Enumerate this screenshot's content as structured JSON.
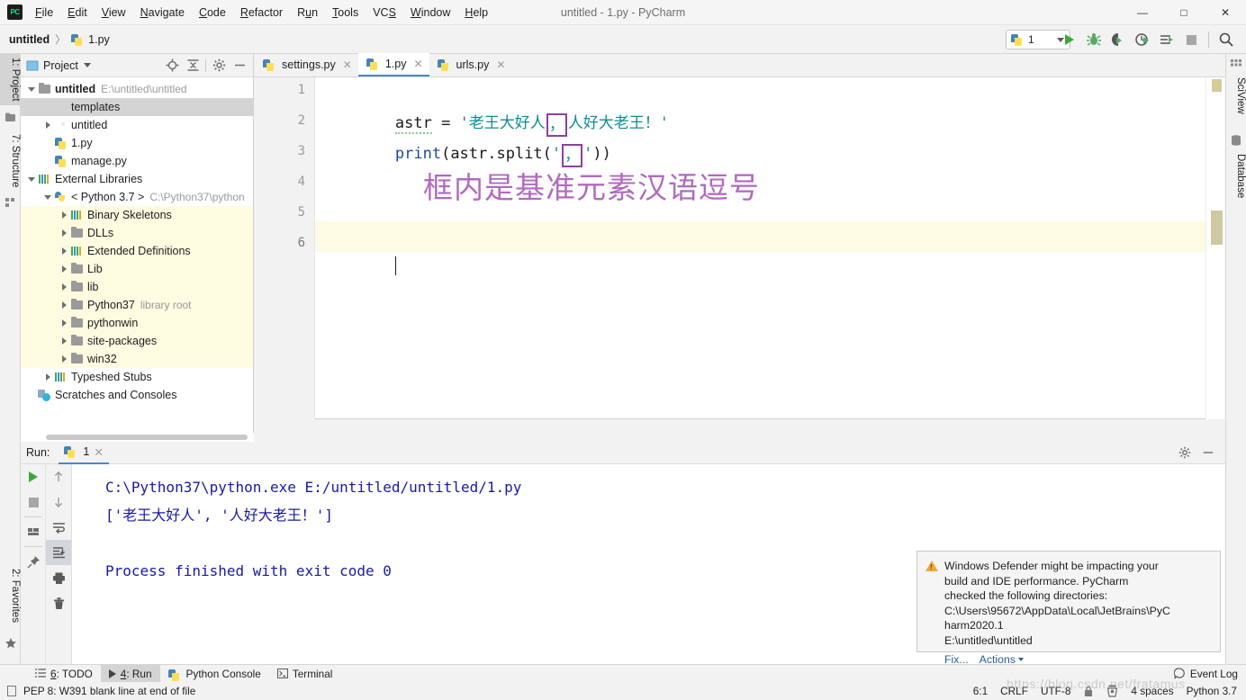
{
  "window": {
    "title": "untitled - 1.py - PyCharm",
    "logo_text": "PC",
    "minimize": "—",
    "maximize": "□",
    "close": "✕"
  },
  "menu": {
    "items": [
      {
        "label": "File"
      },
      {
        "label": "Edit"
      },
      {
        "label": "View"
      },
      {
        "label": "Navigate"
      },
      {
        "label": "Code"
      },
      {
        "label": "Refactor"
      },
      {
        "label": "Run"
      },
      {
        "label": "Tools"
      },
      {
        "label": "VCS"
      },
      {
        "label": "Window"
      },
      {
        "label": "Help"
      }
    ]
  },
  "breadcrumb": {
    "root": "untitled",
    "separator": "〉",
    "file": "1.py"
  },
  "toolbar": {
    "run_config": "1",
    "run_button": "run-icon",
    "debug_button": "debug-icon",
    "coverage_button": "coverage-icon",
    "profile_button": "profile-icon",
    "run_with_console_button": "run-console-icon",
    "stop_button": "stop-icon",
    "search_button": "search-icon"
  },
  "left_strip": {
    "project_tab": "1: Project",
    "structure_tab": "7: Structure",
    "favorites_tab": "2: Favorites"
  },
  "right_strip": {
    "sciview_tab": "SciView",
    "database_tab": "Database"
  },
  "project_panel": {
    "title": "Project",
    "icons": [
      "locate-icon",
      "collapse-all-icon",
      "settings-gear-icon",
      "hide-icon"
    ],
    "tree": [
      {
        "indent": 0,
        "arrow": "down",
        "icon": "folder",
        "label": "untitled",
        "path": "E:\\untitled\\untitled",
        "bold": true,
        "state": ""
      },
      {
        "indent": 1,
        "arrow": "none",
        "icon": "folder-violet",
        "label": "templates",
        "path": "",
        "bold": false,
        "state": "selected"
      },
      {
        "indent": 1,
        "arrow": "right",
        "icon": "folder-src",
        "label": "untitled",
        "path": "",
        "bold": false,
        "state": ""
      },
      {
        "indent": 1,
        "arrow": "none",
        "icon": "py",
        "label": "1.py",
        "path": "",
        "bold": false,
        "state": ""
      },
      {
        "indent": 1,
        "arrow": "none",
        "icon": "py",
        "label": "manage.py",
        "path": "",
        "bold": false,
        "state": ""
      },
      {
        "indent": 0,
        "arrow": "down",
        "icon": "lib",
        "label": "External Libraries",
        "path": "",
        "bold": false,
        "state": ""
      },
      {
        "indent": 1,
        "arrow": "down",
        "icon": "pyi",
        "label": "< Python 3.7 >",
        "path": "C:\\Python37\\python",
        "bold": false,
        "state": ""
      },
      {
        "indent": 2,
        "arrow": "right",
        "icon": "lib",
        "label": "Binary Skeletons",
        "path": "",
        "bold": false,
        "state": "libhl"
      },
      {
        "indent": 2,
        "arrow": "right",
        "icon": "folder",
        "label": "DLLs",
        "path": "",
        "bold": false,
        "state": "libhl"
      },
      {
        "indent": 2,
        "arrow": "right",
        "icon": "lib",
        "label": "Extended Definitions",
        "path": "",
        "bold": false,
        "state": "libhl"
      },
      {
        "indent": 2,
        "arrow": "right",
        "icon": "folder",
        "label": "Lib",
        "path": "",
        "bold": false,
        "state": "libhl"
      },
      {
        "indent": 2,
        "arrow": "right",
        "icon": "folder",
        "label": "lib",
        "path": "",
        "bold": false,
        "state": "libhl"
      },
      {
        "indent": 2,
        "arrow": "right",
        "icon": "folder",
        "label": "Python37",
        "path": "library root",
        "bold": false,
        "state": "libhl"
      },
      {
        "indent": 2,
        "arrow": "right",
        "icon": "folder",
        "label": "pythonwin",
        "path": "",
        "bold": false,
        "state": "libhl"
      },
      {
        "indent": 2,
        "arrow": "right",
        "icon": "folder",
        "label": "site-packages",
        "path": "",
        "bold": false,
        "state": "libhl"
      },
      {
        "indent": 2,
        "arrow": "right",
        "icon": "folder",
        "label": "win32",
        "path": "",
        "bold": false,
        "state": "libhl"
      },
      {
        "indent": 1,
        "arrow": "right",
        "icon": "lib",
        "label": "Typeshed Stubs",
        "path": "",
        "bold": false,
        "state": ""
      },
      {
        "indent": 0,
        "arrow": "none",
        "icon": "scratch",
        "label": "Scratches and Consoles",
        "path": "",
        "bold": false,
        "state": ""
      }
    ]
  },
  "editor": {
    "tabs": [
      {
        "label": "settings.py",
        "active": false,
        "close": "✕"
      },
      {
        "label": "1.py",
        "active": true,
        "close": "✕"
      },
      {
        "label": "urls.py",
        "active": false,
        "close": "✕"
      }
    ],
    "line_numbers": [
      "1",
      "2",
      "3",
      "4",
      "5",
      "6"
    ],
    "code": {
      "line1_var": "astr",
      "line1_eq": " = ",
      "line1_str_open": "'老王大好人",
      "line1_boxed": "，",
      "line1_str_close": "人好大老王！'",
      "line2_fn": "print",
      "line2_open": "(astr.split(",
      "line2_quote1": "'",
      "line2_boxed": "，",
      "line2_quote2": "'",
      "line2_close": "))"
    },
    "annotation": "框内是基准元素汉语逗号",
    "annotation_color": "#b06ac0",
    "box_color": "#8e3fa0",
    "string_color": "#0b8f8f",
    "function_color": "#1c49a0",
    "current_line": 6
  },
  "run_panel": {
    "label": "Run:",
    "tab_name": "1",
    "tab_close": "✕",
    "settings_icon": "gear-icon",
    "hide_icon": "hide-icon",
    "side_buttons": [
      "rerun-icon",
      "stop-icon",
      "console-icon",
      "pin-icon",
      "up-icon",
      "down-icon",
      "soft-wrap-icon",
      "scroll-to-end-icon",
      "print-icon",
      "clear-all-icon"
    ],
    "output": [
      "C:\\Python37\\python.exe E:/untitled/untitled/1.py",
      "['老王大好人', '人好大老王！']",
      "",
      "Process finished with exit code 0"
    ],
    "output_color": "#1a1aa6"
  },
  "notification": {
    "icon": "warning-icon",
    "lines": [
      "Windows Defender might be impacting your",
      "build and IDE performance. PyCharm",
      "checked the following directories:",
      "C:\\Users\\95672\\AppData\\Local\\JetBrains\\PyC",
      "harm2020.1",
      "E:\\untitled\\untitled"
    ],
    "fix_link": "Fix...",
    "actions_link": "Actions",
    "link_color": "#2a6099"
  },
  "toolwindow_bar": {
    "items": [
      {
        "label": "6: TODO",
        "icon": "todo-icon",
        "active": false
      },
      {
        "label": "4: Run",
        "icon": "run-icon",
        "active": true
      },
      {
        "label": "Python Console",
        "icon": "python-icon",
        "active": false
      },
      {
        "label": "Terminal",
        "icon": "terminal-icon",
        "active": false
      }
    ],
    "event_log": "Event Log"
  },
  "statusbar": {
    "message": "PEP 8: W391 blank line at end of file",
    "caret_position": "6:1",
    "line_separator": "CRLF",
    "encoding": "UTF-8",
    "lock_icon": "lock-icon",
    "inspection_icon": "inspector-icon",
    "indent": "4 spaces",
    "interpreter": "Python 3.7"
  },
  "watermark": "https://blog.csdn.net/fratamus"
}
